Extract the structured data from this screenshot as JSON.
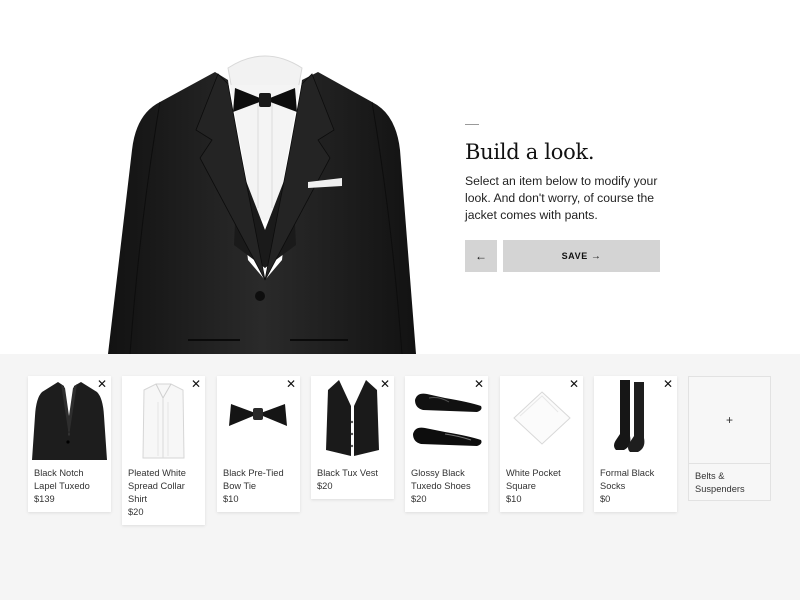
{
  "hero": {
    "title": "Build a look.",
    "description": "Select an item below to modify your look. And don't worry, of course the jacket comes with pants.",
    "back_label": "←",
    "save_label": "SAVE",
    "save_arrow": "→"
  },
  "items": [
    {
      "name": "Black Notch Lapel Tuxedo",
      "price": "$139",
      "close": "✕",
      "icon": "tuxedo-jacket-icon"
    },
    {
      "name": "Pleated White Spread Collar Shirt",
      "price": "$20",
      "close": "✕",
      "icon": "dress-shirt-icon"
    },
    {
      "name": "Black Pre-Tied Bow Tie",
      "price": "$10",
      "close": "✕",
      "icon": "bow-tie-icon"
    },
    {
      "name": "Black Tux Vest",
      "price": "$20",
      "close": "✕",
      "icon": "vest-icon"
    },
    {
      "name": "Glossy Black Tuxedo Shoes",
      "price": "$20",
      "close": "✕",
      "icon": "shoes-icon"
    },
    {
      "name": "White Pocket Square",
      "price": "$10",
      "close": "✕",
      "icon": "pocket-square-icon"
    },
    {
      "name": "Formal Black Socks",
      "price": "$0",
      "close": "✕",
      "icon": "socks-icon"
    }
  ],
  "add_card": {
    "plus": "+",
    "label": "Belts & Suspenders"
  },
  "colors": {
    "tray_background": "#f5f5f5",
    "button_background": "#d4d4d4",
    "suit_black": "#1c1c1c"
  }
}
